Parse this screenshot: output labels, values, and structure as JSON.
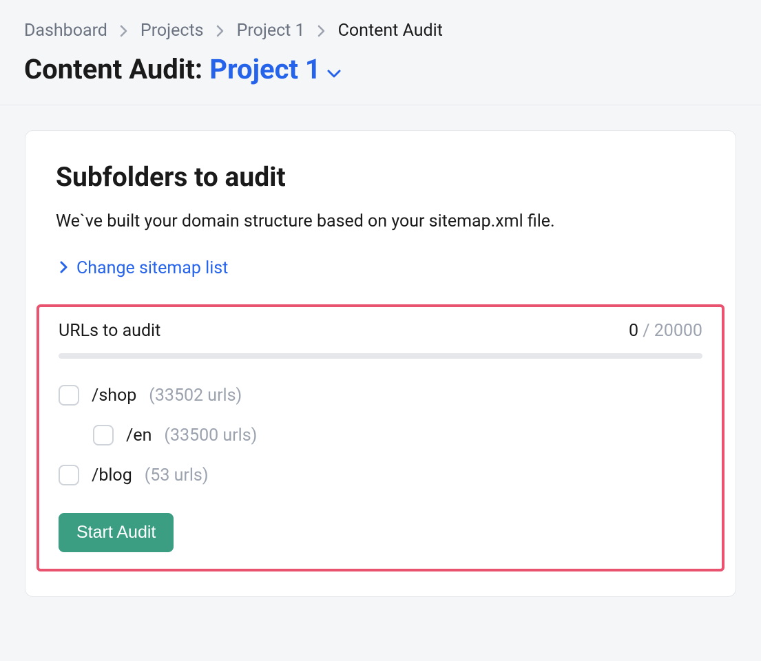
{
  "breadcrumb": [
    {
      "label": "Dashboard",
      "current": false
    },
    {
      "label": "Projects",
      "current": false
    },
    {
      "label": "Project 1",
      "current": false
    },
    {
      "label": "Content Audit",
      "current": true
    }
  ],
  "page_title_prefix": "Content Audit:",
  "project_name": "Project 1",
  "card": {
    "title": "Subfolders to audit",
    "subtitle": "We`ve built your domain structure based on your sitemap.xml file.",
    "change_link": "Change sitemap list",
    "urls_label": "URLs to audit",
    "urls_used": "0",
    "urls_sep": " / ",
    "urls_total": "20000",
    "folders": [
      {
        "path": "/shop",
        "count": "(33502 urls)",
        "indent": false
      },
      {
        "path": "/en",
        "count": "(33500 urls)",
        "indent": true
      },
      {
        "path": "/blog",
        "count": "(53 urls)",
        "indent": false
      }
    ],
    "start_button": "Start Audit"
  }
}
